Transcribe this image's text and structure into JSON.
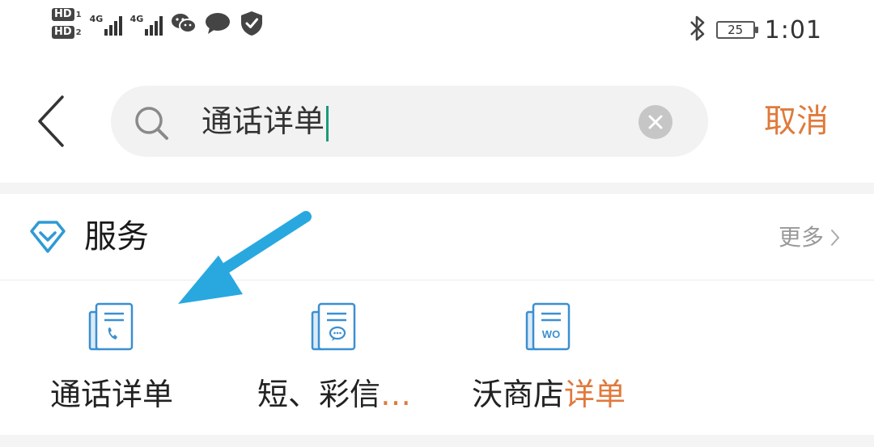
{
  "status_bar": {
    "hd1": "HD",
    "hd1_num": "1",
    "hd2": "HD",
    "hd2_num": "2",
    "network1": "4G",
    "network2": "4G",
    "battery": "25",
    "time": "1:01",
    "icons": [
      "wechat-icon",
      "message-bubble-icon",
      "shield-check-icon",
      "bluetooth-icon"
    ]
  },
  "search": {
    "query": "通话详单",
    "cancel_label": "取消"
  },
  "section": {
    "title": "服务",
    "more_label": "更多",
    "accent": "#2f9ad6"
  },
  "services": [
    {
      "label": "通话详单",
      "highlight": "通话详单",
      "icon": "call-record-icon"
    },
    {
      "label_plain": "短、彩信",
      "label_highlight": "…",
      "icon": "sms-record-icon"
    },
    {
      "label_plain": "沃商店",
      "label_highlight": "详单",
      "icon": "wo-store-record-icon",
      "icon_text": "WO"
    }
  ],
  "colors": {
    "highlight": "#e07a3c",
    "icon_blue": "#3a8fd1",
    "arrow": "#29a8e0"
  }
}
